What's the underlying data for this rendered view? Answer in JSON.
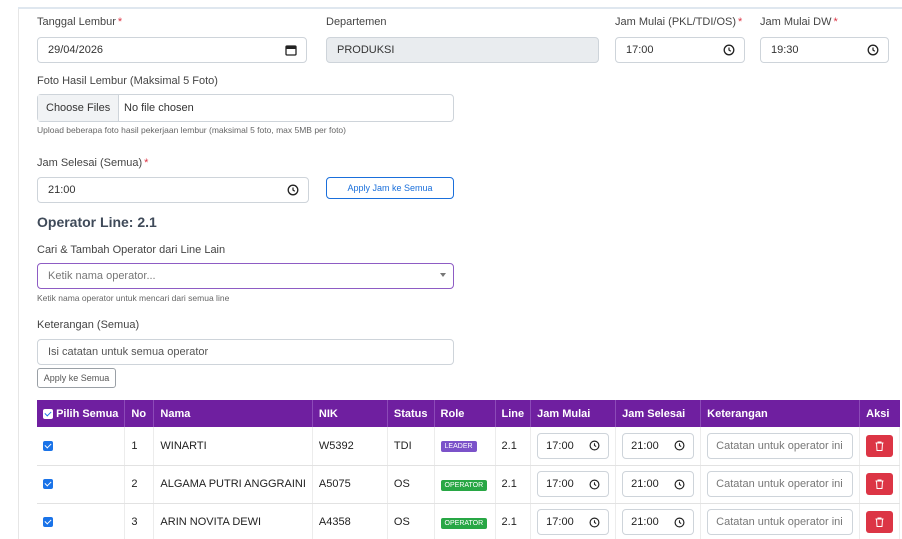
{
  "form": {
    "tanggal_label": "Tanggal Lembur",
    "tanggal_value": "29/04/2026",
    "departemen_label": "Departemen",
    "departemen_value": "PRODUKSI",
    "jam_mulai_label": "Jam Mulai (PKL/TDI/OS)",
    "jam_mulai_value": "17:00",
    "jam_mulai_dw_label": "Jam Mulai DW",
    "jam_mulai_dw_value": "19:30",
    "required_mark": "*",
    "foto_label": "Foto Hasil Lembur (Maksimal 5 Foto)",
    "choose_files": "Choose Files",
    "no_file": "No file chosen",
    "foto_help": "Upload beberapa foto hasil pekerjaan lembur (maksimal 5 foto, max 5MB per foto)",
    "jam_selesai_label": "Jam Selesai (Semua)",
    "jam_selesai_value": "21:00",
    "apply_jam_button": "Apply Jam ke Semua",
    "operator_line_title": "Operator Line: 2.1",
    "cari_label": "Cari & Tambah Operator dari Line Lain",
    "cari_placeholder": "Ketik nama operator...",
    "cari_help": "Ketik nama operator untuk mencari dari semua line",
    "keterangan_label": "Keterangan (Semua)",
    "keterangan_placeholder": "Isi catatan untuk semua operator",
    "apply_ket_button": "Apply ke Semua"
  },
  "table": {
    "headers": [
      "Pilih Semua",
      "No",
      "Nama",
      "NIK",
      "Status",
      "Role",
      "Line",
      "Jam Mulai",
      "Jam Selesai",
      "Keterangan",
      "Aksi"
    ],
    "row_placeholder": "Catatan untuk operator ini",
    "rows": [
      {
        "no": "1",
        "nama": "WINARTI",
        "nik": "W5392",
        "status": "TDI",
        "role": "LEADER",
        "role_color": "#7b52c9",
        "line": "2.1",
        "jam_mulai": "17:00",
        "jam_selesai": "21:00"
      },
      {
        "no": "2",
        "nama": "ALGAMA PUTRI ANGGRAINI",
        "nik": "A5075",
        "status": "OS",
        "role": "OPERATOR",
        "role_color": "#28a745",
        "line": "2.1",
        "jam_mulai": "17:00",
        "jam_selesai": "21:00"
      },
      {
        "no": "3",
        "nama": "ARIN NOVITA DEWI",
        "nik": "A4358",
        "status": "OS",
        "role": "OPERATOR",
        "role_color": "#28a745",
        "line": "2.1",
        "jam_mulai": "17:00",
        "jam_selesai": "21:00"
      }
    ]
  },
  "icons": {
    "calendar": "calendar-icon",
    "clock": "clock-icon",
    "dropdown": "caret-down-icon",
    "trash": "trash-icon",
    "checkbox": "checkbox-checked-icon"
  },
  "colors": {
    "header_bg": "#6f1fa0",
    "primary": "#1a6fdb",
    "danger": "#dc3545"
  }
}
